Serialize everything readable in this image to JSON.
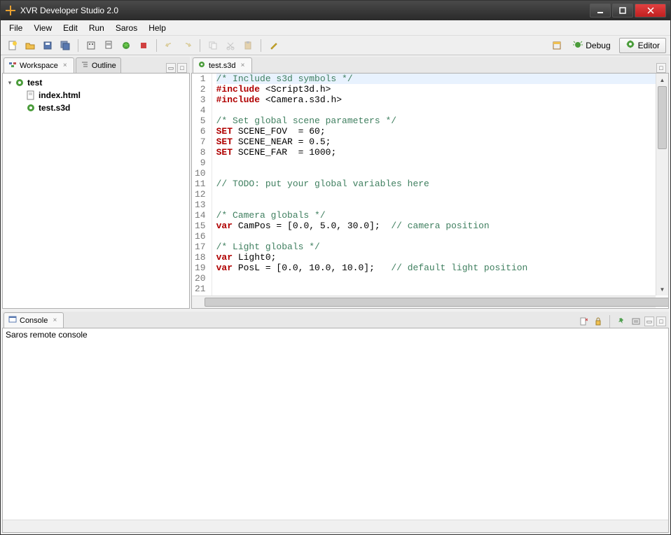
{
  "window": {
    "title": "XVR Developer Studio 2.0"
  },
  "menu": {
    "file": "File",
    "view": "View",
    "edit": "Edit",
    "run": "Run",
    "saros": "Saros",
    "help": "Help"
  },
  "toolbar": {
    "debug": "Debug",
    "editor": "Editor"
  },
  "leftPane": {
    "workspaceTab": "Workspace",
    "outlineTab": "Outline",
    "tree": {
      "project": "test",
      "file1": "index.html",
      "file2": "test.s3d"
    }
  },
  "editor": {
    "tabLabel": "test.s3d",
    "lines": [
      {
        "n": 1,
        "tokens": [
          {
            "t": "/* Include s3d symbols */",
            "c": "tok-comment"
          }
        ],
        "hl": true
      },
      {
        "n": 2,
        "tokens": [
          {
            "t": "#include",
            "c": "tok-red"
          },
          {
            "t": " <Script3d.h>",
            "c": ""
          }
        ]
      },
      {
        "n": 3,
        "tokens": [
          {
            "t": "#include",
            "c": "tok-red"
          },
          {
            "t": " <Camera.s3d.h>",
            "c": ""
          }
        ]
      },
      {
        "n": 4,
        "tokens": []
      },
      {
        "n": 5,
        "tokens": [
          {
            "t": "/* Set global scene parameters */",
            "c": "tok-comment"
          }
        ]
      },
      {
        "n": 6,
        "tokens": [
          {
            "t": "SET",
            "c": "tok-red"
          },
          {
            "t": " SCENE_FOV  = ",
            "c": ""
          },
          {
            "t": "60",
            "c": "tok-number"
          },
          {
            "t": ";",
            "c": ""
          }
        ]
      },
      {
        "n": 7,
        "tokens": [
          {
            "t": "SET",
            "c": "tok-red"
          },
          {
            "t": " SCENE_NEAR = ",
            "c": ""
          },
          {
            "t": "0.5",
            "c": "tok-number"
          },
          {
            "t": ";",
            "c": ""
          }
        ]
      },
      {
        "n": 8,
        "tokens": [
          {
            "t": "SET",
            "c": "tok-red"
          },
          {
            "t": " SCENE_FAR  = ",
            "c": ""
          },
          {
            "t": "1000",
            "c": "tok-number"
          },
          {
            "t": ";",
            "c": ""
          }
        ]
      },
      {
        "n": 9,
        "tokens": []
      },
      {
        "n": 10,
        "tokens": []
      },
      {
        "n": 11,
        "tokens": [
          {
            "t": "// TODO: put your global variables here",
            "c": "tok-comment"
          }
        ]
      },
      {
        "n": 12,
        "tokens": []
      },
      {
        "n": 13,
        "tokens": []
      },
      {
        "n": 14,
        "tokens": [
          {
            "t": "/* Camera globals */",
            "c": "tok-comment"
          }
        ]
      },
      {
        "n": 15,
        "tokens": [
          {
            "t": "var",
            "c": "tok-red"
          },
          {
            "t": " CamPos = [",
            "c": ""
          },
          {
            "t": "0.0",
            "c": "tok-number"
          },
          {
            "t": ", ",
            "c": ""
          },
          {
            "t": "5.0",
            "c": "tok-number"
          },
          {
            "t": ", ",
            "c": ""
          },
          {
            "t": "30.0",
            "c": "tok-number"
          },
          {
            "t": "];  ",
            "c": ""
          },
          {
            "t": "// camera position",
            "c": "tok-comment"
          }
        ]
      },
      {
        "n": 16,
        "tokens": []
      },
      {
        "n": 17,
        "tokens": [
          {
            "t": "/* Light globals */",
            "c": "tok-comment"
          }
        ]
      },
      {
        "n": 18,
        "tokens": [
          {
            "t": "var",
            "c": "tok-red"
          },
          {
            "t": " Light0;",
            "c": ""
          }
        ]
      },
      {
        "n": 19,
        "tokens": [
          {
            "t": "var",
            "c": "tok-red"
          },
          {
            "t": " PosL = [",
            "c": ""
          },
          {
            "t": "0.0",
            "c": "tok-number"
          },
          {
            "t": ", ",
            "c": ""
          },
          {
            "t": "10.0",
            "c": "tok-number"
          },
          {
            "t": ", ",
            "c": ""
          },
          {
            "t": "10.0",
            "c": "tok-number"
          },
          {
            "t": "];   ",
            "c": ""
          },
          {
            "t": "// default light position",
            "c": "tok-comment"
          }
        ]
      },
      {
        "n": 20,
        "tokens": []
      },
      {
        "n": 21,
        "tokens": []
      }
    ]
  },
  "console": {
    "tabLabel": "Console",
    "status": "Saros remote console"
  }
}
